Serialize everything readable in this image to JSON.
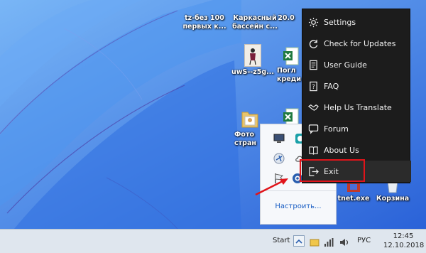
{
  "desktop_icons": [
    {
      "label": "tz-без 100\nпервых к...",
      "icon": "document-icon"
    },
    {
      "label": "Каркасный\nбассейн с...",
      "icon": "word-document-icon"
    },
    {
      "label": "20.0",
      "icon": "folder-icon"
    },
    {
      "label": "uwS--z5g...",
      "icon": "image-file-icon"
    },
    {
      "label": "Погл\nкреди",
      "icon": "excel-icon"
    },
    {
      "label": "Фото\nстран",
      "icon": "folder-icon"
    },
    {
      "label": "tnet.exe",
      "icon": "app-icon"
    },
    {
      "label": "Корзина",
      "icon": "recycle-bin-icon"
    }
  ],
  "tray_popup": {
    "icons": [
      "monitor-icon",
      "app-icon",
      "network-icon",
      "cloud-icon",
      "flag-icon",
      "vpn-icon"
    ],
    "customize_label": "Настроить..."
  },
  "context_menu": {
    "items": [
      {
        "label": "Settings",
        "icon": "gear-icon"
      },
      {
        "label": "Check for Updates",
        "icon": "refresh-icon"
      },
      {
        "label": "User Guide",
        "icon": "guide-icon"
      },
      {
        "label": "FAQ",
        "icon": "faq-icon"
      },
      {
        "label": "Help Us Translate",
        "icon": "handshake-icon"
      },
      {
        "label": "Forum",
        "icon": "forum-icon"
      },
      {
        "label": "About Us",
        "icon": "about-icon"
      },
      {
        "label": "Exit",
        "icon": "exit-icon"
      }
    ],
    "highlight_color": "#e0141a"
  },
  "taskbar": {
    "start_label": "Start",
    "language": "РУС",
    "time": "12:45",
    "date": "12.10.2018"
  }
}
